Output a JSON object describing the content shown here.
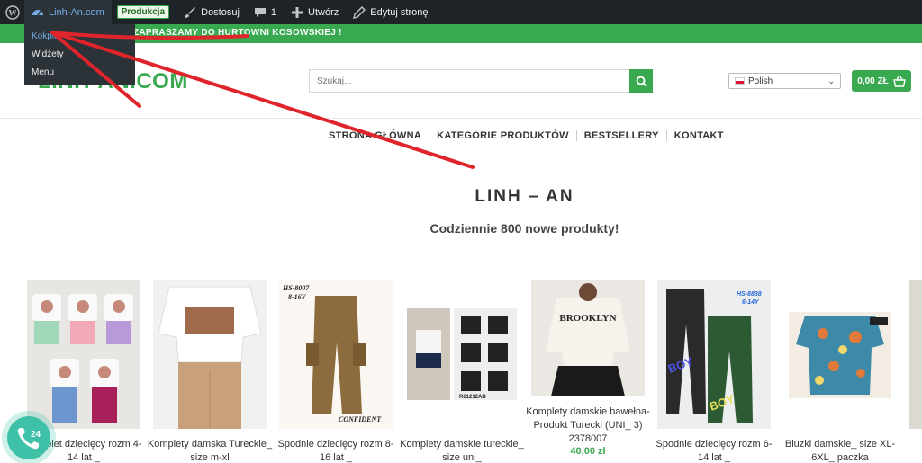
{
  "adminbar": {
    "site_name": "Linh-An.com",
    "env_badge": "Produkcja",
    "customize": "Dostosuj",
    "comments_count": "1",
    "new": "Utwórz",
    "edit_page": "Edytuj stronę"
  },
  "dropdown": {
    "items": [
      "Kokpit",
      "Widżety",
      "Menu"
    ]
  },
  "promo": {
    "text": "ZAPRASZAMY DO HURTOWNI KOSOWSKIEJ !"
  },
  "header": {
    "logo": "LINH-AN.COM",
    "search_placeholder": "Szukaj...",
    "language": "Polish",
    "cart_total": "0,00 ZŁ"
  },
  "nav": {
    "items": [
      "STRONA GŁÓWNA",
      "KATEGORIE PRODUKTÓW",
      "BESTSELLERY",
      "KONTAKT"
    ]
  },
  "hero": {
    "title": "LINH – AN",
    "subtitle": "Codziennie 800 nowe produkty!"
  },
  "products": [
    {
      "name": "Komplet dziecięcy rozm 4-14 lat _",
      "price": ""
    },
    {
      "name": "Komplety damska Tureckie_ size m-xl",
      "price": ""
    },
    {
      "name": "Spodnie dziecięcy rozm 8-16 lat _",
      "price": "",
      "img_text_top": "HS-8007 8-16Y",
      "img_text_bottom": "CONFIDENT"
    },
    {
      "name": "Komplety damskie tureckie_ size uni_",
      "price": "",
      "img_text_bottom": "R61212AB"
    },
    {
      "name": "Komplety damskie bawełna-Produkt Turecki (UNI_ 3) 2378007",
      "price": "40,00 zł",
      "img_text_top": "BROOKLYN"
    },
    {
      "name": "Spodnie dziecięcy rozm 6-14 lat _",
      "price": "",
      "img_text_top": "HS-8838 6-14Y"
    },
    {
      "name": "Bluzki damskie_ size XL-6XL_ paczka",
      "price": ""
    }
  ],
  "colors": {
    "brand_green": "#39a94f",
    "adminbar_bg": "#1d2327",
    "annotation_red": "#e0242b"
  },
  "icons": {
    "wp": "wordpress-icon",
    "site": "dashboard-icon",
    "brush": "brush-icon",
    "comment": "comment-icon",
    "plus": "plus-icon",
    "pencil": "pencil-icon",
    "search": "search-icon",
    "cart": "basket-icon",
    "phone": "phone-24-icon"
  }
}
